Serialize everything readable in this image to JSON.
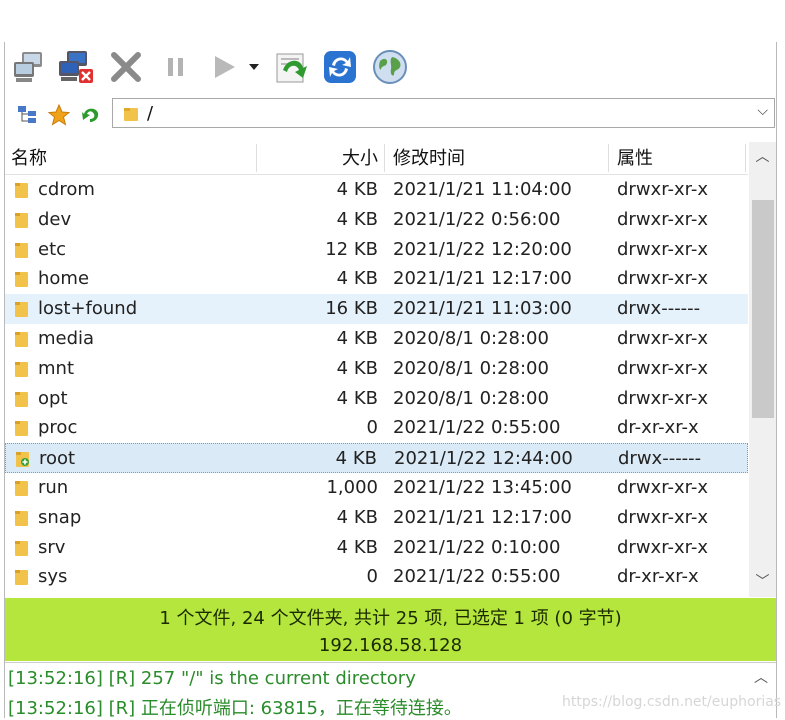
{
  "toolbar": {
    "buttons": [
      {
        "name": "connect-button",
        "icon": "computers-icon"
      },
      {
        "name": "disconnect-button",
        "icon": "computer-disconnect-icon"
      },
      {
        "name": "stop-button",
        "icon": "cross-icon"
      },
      {
        "name": "pause-button",
        "icon": "pause-icon"
      },
      {
        "name": "play-button",
        "icon": "play-icon"
      },
      {
        "name": "play-dropdown-button",
        "icon": "caret-down-icon"
      },
      {
        "name": "go-up-button",
        "icon": "folder-arrow-icon"
      },
      {
        "name": "refresh-button",
        "icon": "refresh-icon"
      },
      {
        "name": "globe-button",
        "icon": "globe-icon"
      }
    ]
  },
  "address": {
    "path": "/"
  },
  "columns": {
    "name": "名称",
    "size": "大小",
    "modified": "修改时间",
    "attr": "属性"
  },
  "files": [
    {
      "name": "cdrom",
      "size": "4 KB",
      "modified": "2021/1/21 11:04:00",
      "attr": "drwxr-xr-x",
      "state": ""
    },
    {
      "name": "dev",
      "size": "4 KB",
      "modified": "2021/1/22 0:56:00",
      "attr": "drwxr-xr-x",
      "state": ""
    },
    {
      "name": "etc",
      "size": "12 KB",
      "modified": "2021/1/22 12:20:00",
      "attr": "drwxr-xr-x",
      "state": ""
    },
    {
      "name": "home",
      "size": "4 KB",
      "modified": "2021/1/21 12:17:00",
      "attr": "drwxr-xr-x",
      "state": ""
    },
    {
      "name": "lost+found",
      "size": "16 KB",
      "modified": "2021/1/21 11:03:00",
      "attr": "drwx------",
      "state": "hover"
    },
    {
      "name": "media",
      "size": "4 KB",
      "modified": "2020/8/1 0:28:00",
      "attr": "drwxr-xr-x",
      "state": ""
    },
    {
      "name": "mnt",
      "size": "4 KB",
      "modified": "2020/8/1 0:28:00",
      "attr": "drwxr-xr-x",
      "state": ""
    },
    {
      "name": "opt",
      "size": "4 KB",
      "modified": "2020/8/1 0:28:00",
      "attr": "drwxr-xr-x",
      "state": ""
    },
    {
      "name": "proc",
      "size": "0",
      "modified": "2021/1/22 0:55:00",
      "attr": "dr-xr-xr-x",
      "state": ""
    },
    {
      "name": "root",
      "size": "4 KB",
      "modified": "2021/1/22 12:44:00",
      "attr": "drwx------",
      "state": "selected"
    },
    {
      "name": "run",
      "size": "1,000",
      "modified": "2021/1/22 13:45:00",
      "attr": "drwxr-xr-x",
      "state": ""
    },
    {
      "name": "snap",
      "size": "4 KB",
      "modified": "2021/1/21 12:17:00",
      "attr": "drwxr-xr-x",
      "state": ""
    },
    {
      "name": "srv",
      "size": "4 KB",
      "modified": "2021/1/22 0:10:00",
      "attr": "drwxr-xr-x",
      "state": ""
    },
    {
      "name": "sys",
      "size": "0",
      "modified": "2021/1/22 0:55:00",
      "attr": "dr-xr-xr-x",
      "state": ""
    }
  ],
  "status": {
    "summary": "1 个文件, 24 个文件夹, 共计 25 项, 已选定 1 项 (0 字节)",
    "host": "192.168.58.128",
    "color": "#b5e63d"
  },
  "log": [
    "[13:52:16] [R] 257 \"/\" is the current directory",
    "[13:52:16] [R] 正在侦听端口: 63815，正在等待连接。"
  ],
  "watermark": "https://blog.csdn.net/euphorias"
}
